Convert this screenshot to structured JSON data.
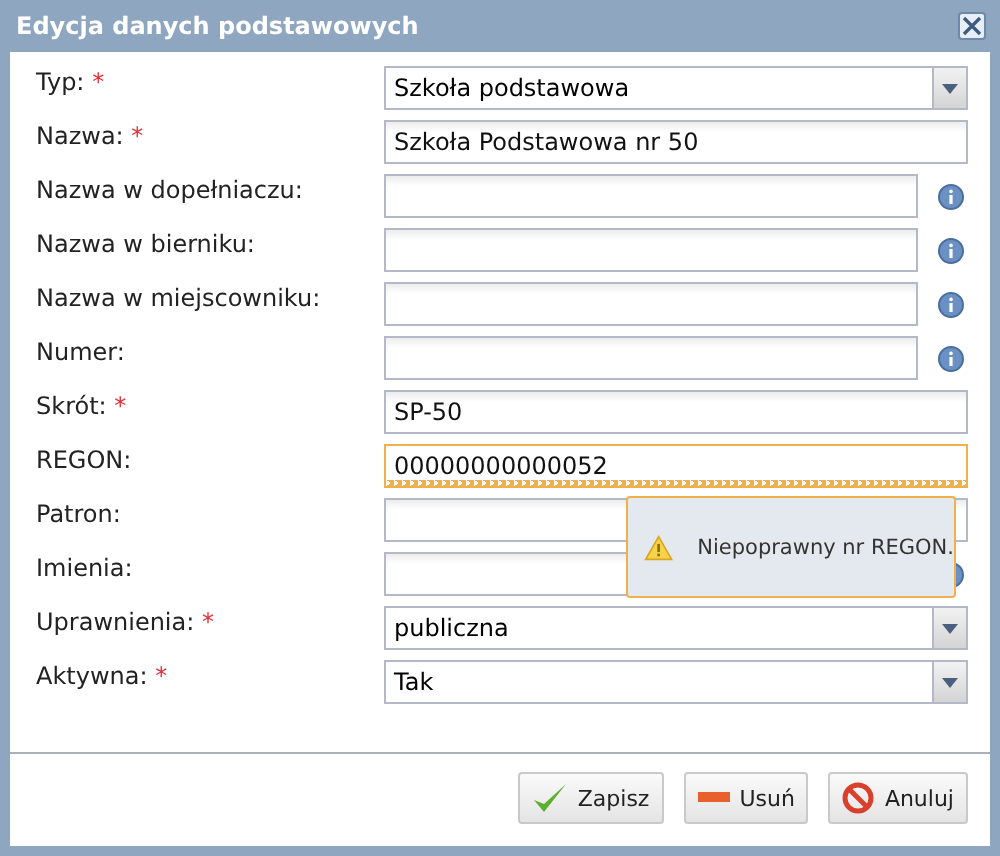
{
  "window": {
    "title": "Edycja danych podstawowych"
  },
  "fields": [
    {
      "label": "Typ:",
      "required_mark": "*",
      "kind": "select",
      "value": "Szkoła podstawowa"
    },
    {
      "label": "Nazwa:",
      "required_mark": "*",
      "kind": "text",
      "value": "Szkoła Podstawowa nr 50"
    },
    {
      "label": "Nazwa w dopełniaczu:",
      "kind": "text_info"
    },
    {
      "label": "Nazwa w bierniku:",
      "kind": "text_info"
    },
    {
      "label": "Nazwa w miejscowniku:",
      "kind": "text_info"
    },
    {
      "label": "Numer:",
      "kind": "text_info"
    },
    {
      "label": "Skrót:",
      "required_mark": "*",
      "kind": "text",
      "value": "SP-50"
    },
    {
      "label": "REGON:",
      "kind": "text",
      "value": "00000000000052",
      "invalid": true
    },
    {
      "label": "Patron:",
      "kind": "text"
    },
    {
      "label": "Imienia:",
      "kind": "text_info"
    },
    {
      "label": "Uprawnienia:",
      "required_mark": "*",
      "kind": "select",
      "value": "publiczna"
    },
    {
      "label": "Aktywna:",
      "required_mark": "*",
      "kind": "select",
      "value": "Tak"
    }
  ],
  "tooltip": {
    "text": "Niepoprawny nr REGON."
  },
  "buttons": [
    {
      "label": "Zapisz",
      "kind": "save"
    },
    {
      "label": "Usuń",
      "kind": "delete"
    },
    {
      "label": "Anuluj",
      "kind": "cancel"
    }
  ]
}
